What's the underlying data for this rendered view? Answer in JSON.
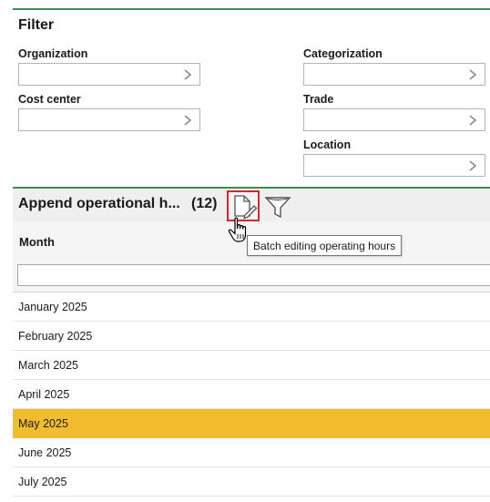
{
  "filter": {
    "title": "Filter",
    "fields": {
      "organization": "Organization",
      "cost_center": "Cost center",
      "categorization": "Categorization",
      "trade": "Trade",
      "location": "Location"
    }
  },
  "section": {
    "title": "Append operational h...",
    "count": "(12)",
    "tooltip": "Batch editing operating hours",
    "accent_color": "#3f8f4f",
    "highlight_color": "#d9262a"
  },
  "table": {
    "column_header": "Month",
    "search_value": "",
    "rows": [
      {
        "month": "January 2025"
      },
      {
        "month": "February 2025"
      },
      {
        "month": "March 2025"
      },
      {
        "month": "April 2025"
      },
      {
        "month": "May 2025"
      },
      {
        "month": "June 2025"
      },
      {
        "month": "July 2025"
      }
    ],
    "selected_row_index": 4,
    "selected_color": "#f2bd2c"
  },
  "icons": {
    "batch_edit": "batch-edit-icon",
    "filter": "funnel-icon",
    "chevron": "chevron-right-icon",
    "cursor": "hand-pointer-icon"
  }
}
